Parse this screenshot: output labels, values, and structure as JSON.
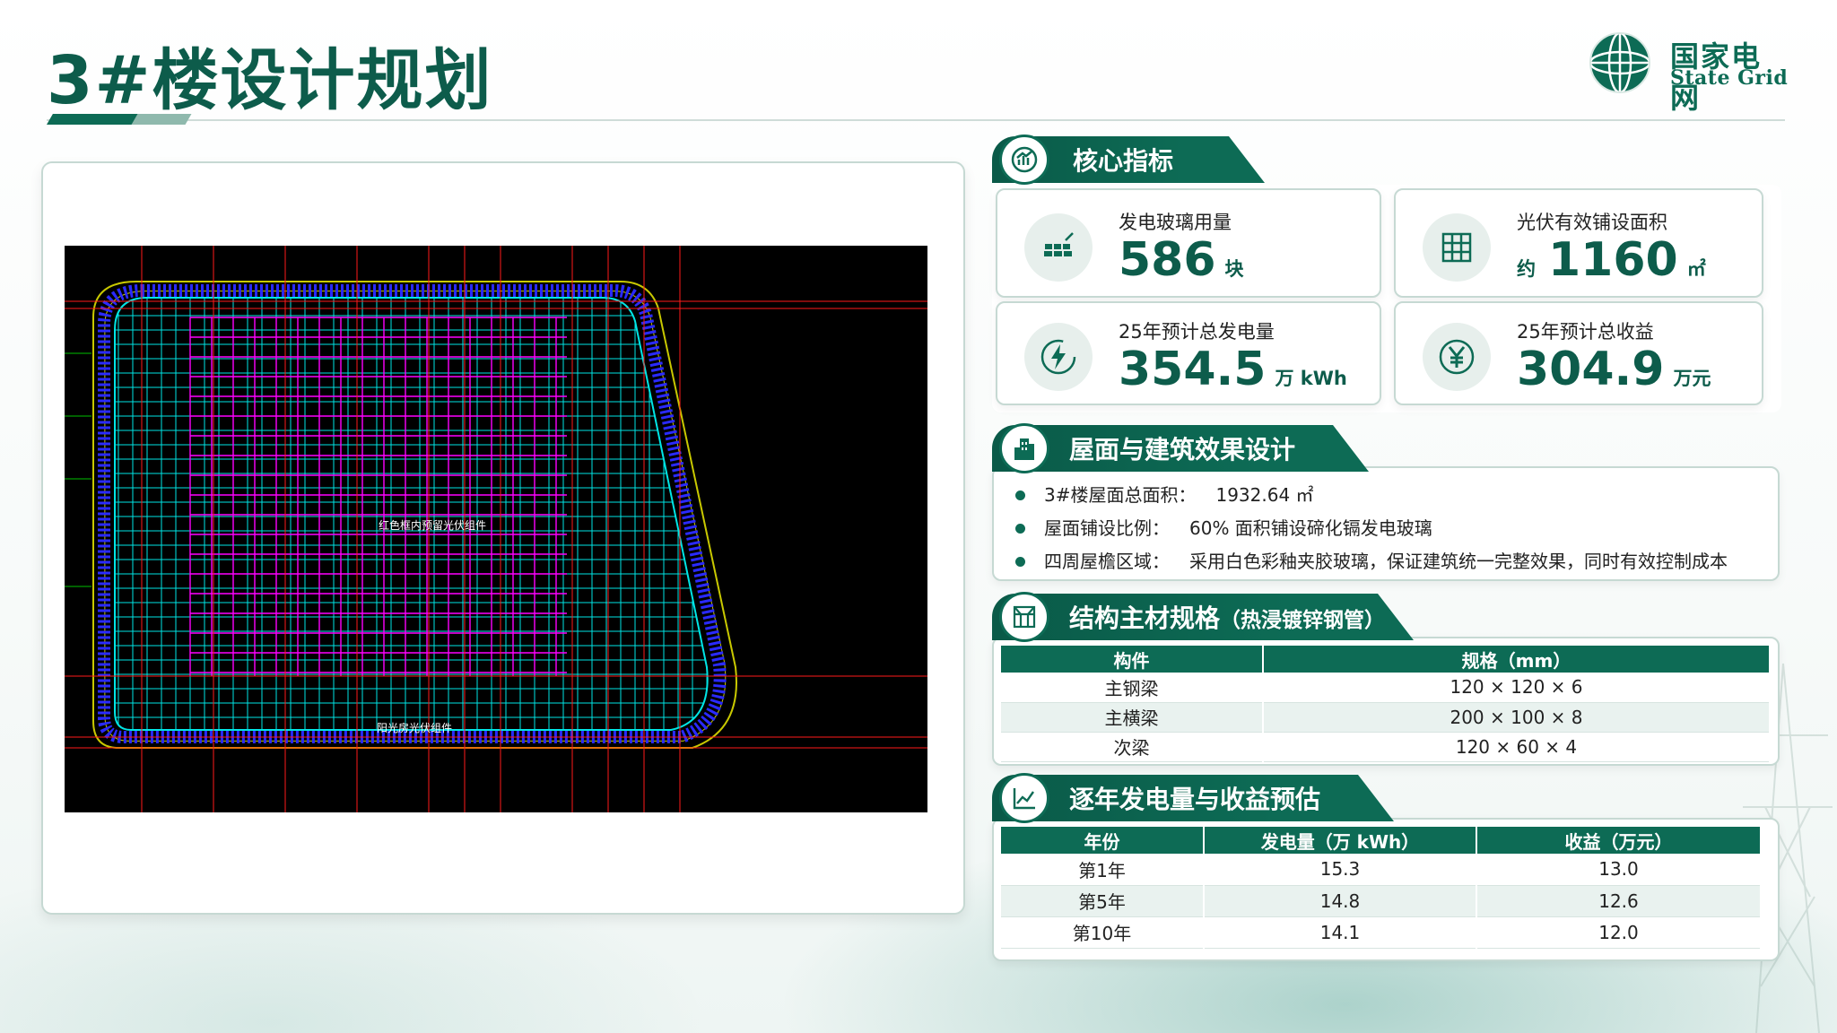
{
  "page": {
    "title": "3#楼设计规划"
  },
  "logo": {
    "cn": "国家电网",
    "en": "State Grid"
  },
  "drawing": {
    "label_top": "红色框内预留光伏组件",
    "label_bottom": "阳光房光伏组件"
  },
  "core": {
    "title": "核心指标",
    "icon": "chart-icon",
    "metrics": [
      {
        "label": "发电玻璃用量",
        "prefix": "",
        "value": "586",
        "unit": "块",
        "icon": "solar-panel-icon"
      },
      {
        "label": "光伏有效铺设面积",
        "prefix": "约",
        "value": "1160",
        "unit": "㎡",
        "icon": "grid-icon"
      },
      {
        "label": "25年预计总发电量",
        "prefix": "",
        "value": "354.5",
        "unit": "万 kWh",
        "icon": "lightning-icon"
      },
      {
        "label": "25年预计总收益",
        "prefix": "",
        "value": "304.9",
        "unit": "万元",
        "icon": "yuan-icon"
      }
    ]
  },
  "roof": {
    "title": "屋面与建筑效果设计",
    "icon": "building-icon",
    "items": [
      {
        "key": "3#楼屋面总面积：",
        "value": "1932.64 ㎡"
      },
      {
        "key": "屋面铺设比例：",
        "value": "60% 面积铺设碲化镉发电玻璃"
      },
      {
        "key": "四周屋檐区域：",
        "value": "采用白色彩釉夹胶玻璃，保证建筑统一完整效果，同时有效控制成本"
      }
    ]
  },
  "structure": {
    "title": "结构主材规格",
    "subtitle": "（热浸镀锌钢管）",
    "icon": "structure-icon",
    "headers": [
      "构件",
      "规格（mm）"
    ],
    "rows": [
      [
        "主钢梁",
        "120 × 120 × 6"
      ],
      [
        "主横梁",
        "200 × 100 × 8"
      ],
      [
        "次梁",
        "120 × 60 × 4"
      ]
    ]
  },
  "yearly": {
    "title": "逐年发电量与收益预估",
    "icon": "trend-icon",
    "headers": [
      "年份",
      "发电量（万 kWh）",
      "收益（万元）"
    ],
    "rows": [
      [
        "第1年",
        "15.3",
        "13.0"
      ],
      [
        "第5年",
        "14.8",
        "12.6"
      ],
      [
        "第10年",
        "14.1",
        "12.0"
      ]
    ]
  },
  "colors": {
    "brand": "#0d6b55",
    "cad_grid": "#00e5e5",
    "cad_magenta": "#ff00ff",
    "cad_red": "#ff1a1a"
  }
}
